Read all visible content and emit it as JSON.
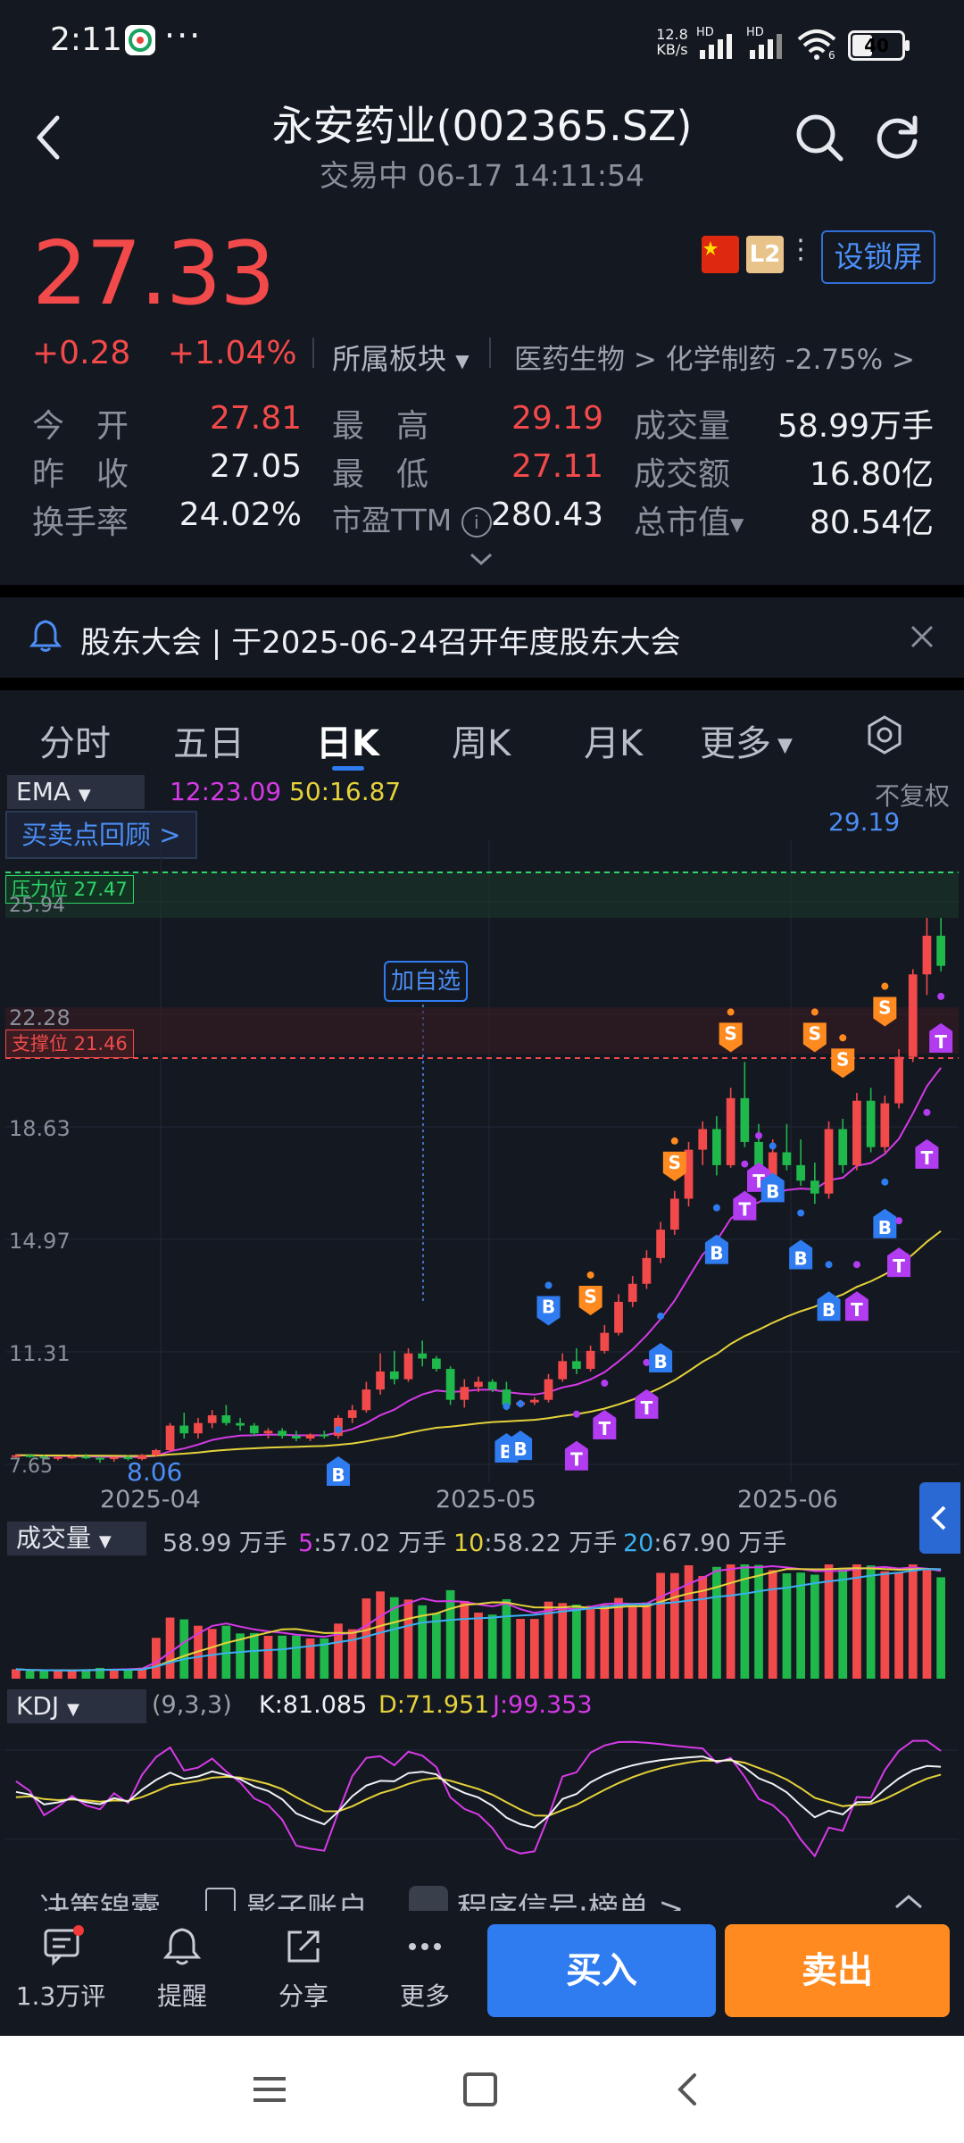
{
  "status": {
    "time": "2:11",
    "dots": "···",
    "net_speed_top": "12.8",
    "net_speed_bottom": "KB/s",
    "battery": "40",
    "wifi_sub": "6",
    "hd1": "HD",
    "hd2": "HD"
  },
  "header": {
    "title": "永安药业(002365.SZ)",
    "subtitle": "交易中 06-17 14:11:54",
    "badge_l2": "L2",
    "lock_button": "设锁屏"
  },
  "quote": {
    "price": "27.33",
    "change": "+0.28",
    "change_pct": "+1.04%",
    "sector_label": "所属板块",
    "sector_path": "医药生物 > 化学制药 -2.75% >",
    "rows": [
      {
        "l1": "今　开",
        "v1": "27.81",
        "l2": "最　高",
        "v2": "29.19",
        "l3": "成交量",
        "v3": "58.99万手"
      },
      {
        "l1": "昨　收",
        "v1": "27.05",
        "l2": "最　低",
        "v2": "27.11",
        "l3": "成交额",
        "v3": "16.80亿"
      },
      {
        "l1": "换手率",
        "v1": "24.02%",
        "l2": "市盈TTM",
        "v2": "280.43",
        "l3": "总市值",
        "v3": "80.54亿"
      }
    ]
  },
  "notice": {
    "text": "股东大会 | 于2025-06-24召开年度股东大会"
  },
  "tabs": [
    "分时",
    "五日",
    "日K",
    "周K",
    "月K",
    "更多"
  ],
  "kline": {
    "indicator": "EMA",
    "ema12_label": "12:23.09",
    "ema50_label": "50:16.87",
    "adjust": "不复权",
    "review_button": "买卖点回顾 >",
    "max_label": "29.19",
    "min_label": "8.06",
    "pressure": "压力位 27.47",
    "support": "支撑位 21.46",
    "add_watch": "加自选",
    "y_ticks": [
      "25.94",
      "22.28",
      "18.63",
      "14.97",
      "11.31",
      "7.65"
    ],
    "x_ticks": [
      "2025-04",
      "2025-05",
      "2025-06"
    ],
    "colors": {
      "up": "#f24a4a",
      "down": "#1fb84a",
      "ema12": "#d63ae6",
      "ema50": "#e5d23a"
    }
  },
  "volume": {
    "label": "成交量",
    "value": "58.99 万手",
    "ma5_key": "5",
    "ma5": ":57.02 万手",
    "ma10_key": "10",
    "ma10": ":58.22 万手",
    "ma20_key": "20",
    "ma20": ":67.90 万手"
  },
  "kdj": {
    "label": "KDJ",
    "params": "(9,3,3)",
    "k": "K:81.085",
    "d": "D:71.951",
    "j": "J:99.353"
  },
  "strip": {
    "item1": "决策锦囊",
    "item2": "影子账户",
    "item3": "程序信号·榜单 >"
  },
  "bottom": {
    "comments": "1.3万评",
    "remind": "提醒",
    "share": "分享",
    "more": "更多",
    "buy": "买入",
    "sell": "卖出"
  },
  "chart_data": {
    "type": "candlestick",
    "title": "",
    "ylim": [
      7.65,
      29.94
    ],
    "x_ticks": [
      "2025-04",
      "2025-05",
      "2025-06"
    ],
    "candles": [
      [
        8.3,
        8.4,
        8.2,
        8.35
      ],
      [
        8.35,
        8.4,
        8.25,
        8.3
      ],
      [
        8.3,
        8.35,
        8.2,
        8.25
      ],
      [
        8.25,
        8.3,
        8.15,
        8.28
      ],
      [
        8.28,
        8.35,
        8.2,
        8.3
      ],
      [
        8.3,
        8.4,
        8.2,
        8.25
      ],
      [
        8.25,
        8.3,
        8.06,
        8.2
      ],
      [
        8.2,
        8.3,
        8.1,
        8.28
      ],
      [
        8.28,
        8.35,
        8.15,
        8.2
      ],
      [
        8.2,
        8.4,
        8.15,
        8.35
      ],
      [
        8.35,
        8.6,
        8.3,
        8.55
      ],
      [
        8.55,
        9.6,
        8.5,
        9.5
      ],
      [
        9.5,
        10.0,
        9.0,
        9.2
      ],
      [
        9.2,
        9.8,
        9.0,
        9.6
      ],
      [
        9.6,
        10.1,
        9.4,
        9.9
      ],
      [
        9.9,
        10.3,
        9.5,
        9.6
      ],
      [
        9.6,
        9.8,
        9.3,
        9.5
      ],
      [
        9.5,
        9.6,
        9.1,
        9.2
      ],
      [
        9.2,
        9.4,
        9.0,
        9.3
      ],
      [
        9.3,
        9.4,
        9.0,
        9.1
      ],
      [
        9.1,
        9.3,
        8.9,
        9.0
      ],
      [
        9.0,
        9.2,
        8.9,
        9.15
      ],
      [
        9.15,
        9.3,
        9.0,
        9.1
      ],
      [
        9.1,
        9.9,
        9.0,
        9.8
      ],
      [
        9.8,
        10.3,
        9.6,
        10.1
      ],
      [
        10.1,
        11.2,
        10.0,
        10.9
      ],
      [
        10.9,
        12.3,
        10.7,
        11.6
      ],
      [
        11.6,
        12.4,
        11.1,
        11.3
      ],
      [
        11.3,
        12.5,
        11.2,
        12.3
      ],
      [
        12.3,
        12.8,
        11.8,
        12.1
      ],
      [
        12.1,
        12.2,
        11.6,
        11.7
      ],
      [
        11.7,
        11.8,
        10.3,
        10.5
      ],
      [
        10.5,
        11.3,
        10.2,
        11.0
      ],
      [
        11.0,
        11.4,
        10.8,
        11.2
      ],
      [
        11.2,
        11.3,
        10.8,
        10.9
      ],
      [
        10.9,
        11.2,
        10.1,
        10.3
      ],
      [
        10.3,
        10.5,
        10.2,
        10.4
      ],
      [
        10.4,
        10.6,
        10.3,
        10.5
      ],
      [
        10.5,
        11.5,
        10.4,
        11.3
      ],
      [
        11.3,
        12.3,
        11.2,
        12.0
      ],
      [
        12.0,
        12.5,
        11.5,
        11.7
      ],
      [
        11.7,
        12.6,
        11.6,
        12.4
      ],
      [
        12.4,
        13.4,
        12.3,
        13.1
      ],
      [
        13.1,
        14.6,
        13.0,
        14.3
      ],
      [
        14.3,
        15.3,
        14.1,
        15.0
      ],
      [
        15.0,
        16.3,
        14.8,
        16.0
      ],
      [
        16.0,
        17.4,
        15.8,
        17.1
      ],
      [
        17.1,
        18.6,
        16.9,
        18.3
      ],
      [
        18.3,
        20.5,
        18.0,
        20.2
      ],
      [
        20.2,
        21.3,
        19.6,
        21.0
      ],
      [
        21.0,
        21.5,
        19.2,
        19.6
      ],
      [
        19.6,
        22.6,
        19.5,
        22.2
      ],
      [
        22.2,
        23.6,
        20.3,
        20.5
      ],
      [
        20.5,
        21.2,
        18.8,
        19.2
      ],
      [
        19.2,
        20.6,
        18.5,
        20.1
      ],
      [
        20.1,
        21.2,
        19.4,
        19.6
      ],
      [
        19.6,
        20.6,
        18.8,
        19.0
      ],
      [
        19.0,
        19.7,
        18.1,
        18.5
      ],
      [
        18.5,
        21.3,
        18.3,
        21.0
      ],
      [
        21.0,
        21.4,
        19.3,
        19.6
      ],
      [
        19.6,
        22.4,
        19.4,
        22.1
      ],
      [
        22.1,
        22.6,
        20.1,
        20.3
      ],
      [
        20.3,
        22.3,
        20.1,
        22.0
      ],
      [
        22.0,
        24.1,
        21.8,
        23.8
      ],
      [
        23.8,
        27.2,
        23.6,
        27.0
      ],
      [
        27.0,
        29.19,
        26.2,
        28.5
      ],
      [
        28.5,
        29.19,
        27.11,
        27.33
      ]
    ],
    "ema12_current": 23.09,
    "ema50_current": 16.87,
    "pressure_level": 27.47,
    "support_level": 21.46
  }
}
